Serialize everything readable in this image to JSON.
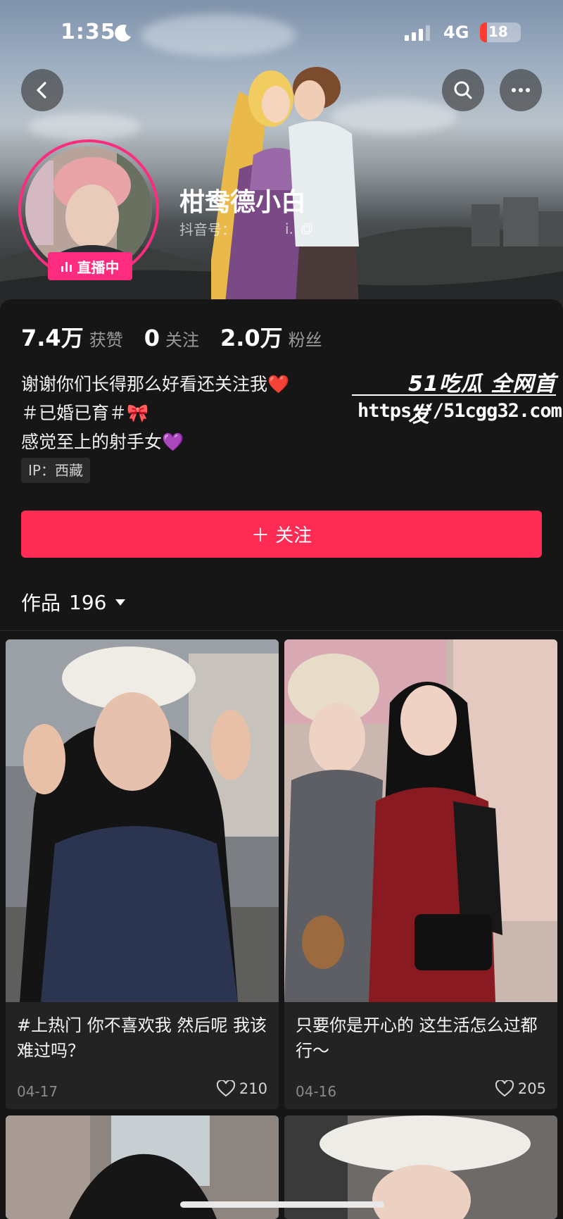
{
  "status_bar": {
    "time": "1:35",
    "network": "4G",
    "battery": "18"
  },
  "profile": {
    "nickname": "柑鸯德小白",
    "douyin_id_label": "抖音号：",
    "douyin_id_value": "i.",
    "live_badge": "直播中",
    "stats": [
      {
        "value": "7.4万",
        "label": "获赞"
      },
      {
        "value": "0",
        "label": "关注"
      },
      {
        "value": "2.0万",
        "label": "粉丝"
      }
    ],
    "bio_lines": [
      "谢谢你们长得那么好看还关注我❤️",
      "＃已婚已育＃🎀",
      "感觉至上的射手女💜"
    ],
    "ip": "IP：西藏",
    "follow_button": "＋ 关注",
    "works_label": "作品",
    "works_count": "196"
  },
  "watermark": {
    "logo": "51吃瓜 全网首发",
    "url": "https://51cgg32.com"
  },
  "posts": [
    {
      "title": "#上热门 你不喜欢我 然后呢 我该难过吗？",
      "date": "04-17",
      "likes": "210"
    },
    {
      "title": "只要你是开心的 这生活怎么过都行～",
      "date": "04-16",
      "likes": "205"
    }
  ],
  "colors": {
    "accent": "#fe2c55",
    "live": "#fe2c7e",
    "background": "#161616"
  }
}
